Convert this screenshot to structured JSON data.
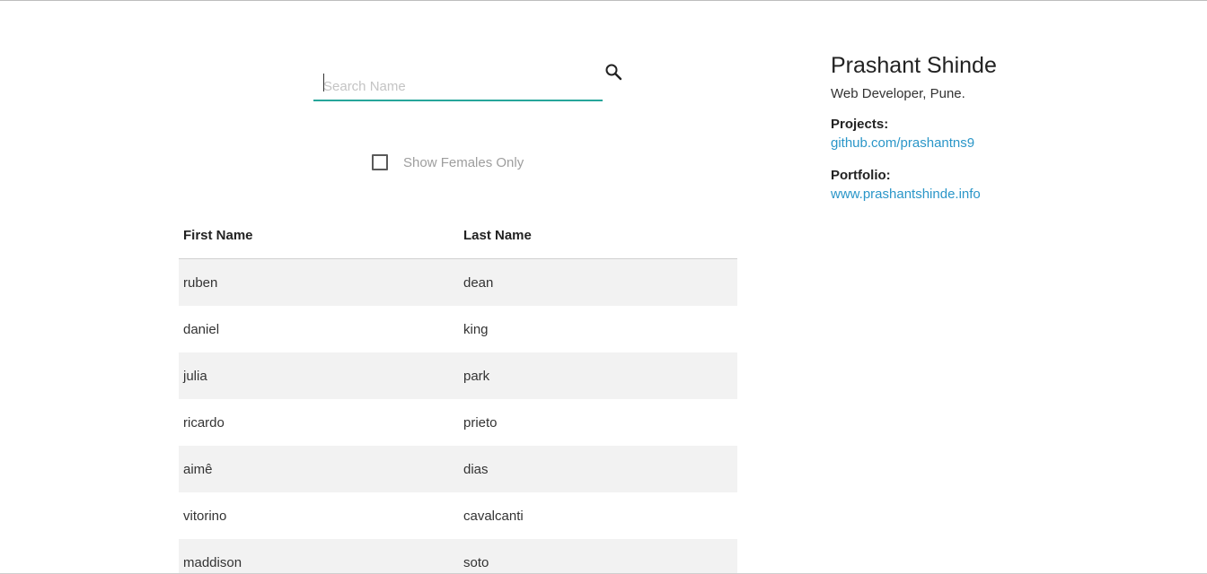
{
  "search": {
    "placeholder": "Search Name",
    "value": "",
    "icon": "search-icon"
  },
  "filter": {
    "label": "Show Females Only",
    "checked": false
  },
  "table": {
    "headers": [
      "First Name",
      "Last Name"
    ],
    "rows": [
      [
        "ruben",
        "dean"
      ],
      [
        "daniel",
        "king"
      ],
      [
        "julia",
        "park"
      ],
      [
        "ricardo",
        "prieto"
      ],
      [
        "aimê",
        "dias"
      ],
      [
        "vitorino",
        "cavalcanti"
      ],
      [
        "maddison",
        "soto"
      ]
    ]
  },
  "profile": {
    "name": "Prashant Shinde",
    "role": "Web Developer, Pune.",
    "projects_label": "Projects:",
    "projects_link": "github.com/prashantns9",
    "portfolio_label": "Portfolio:",
    "portfolio_link": "www.prashantshinde.info"
  },
  "colors": {
    "accent": "#26a69a",
    "link": "#2a96c8",
    "stripe": "#f2f2f2"
  }
}
